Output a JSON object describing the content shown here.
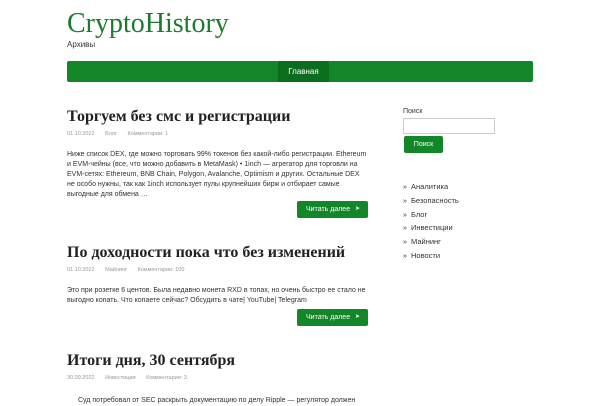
{
  "site": {
    "title": "CryptoHistory",
    "description": "Архивы"
  },
  "nav": {
    "home_label": "Главная"
  },
  "posts": [
    {
      "title": "Торгуем без смс и регистрации",
      "date": "01.10.2022",
      "category": "Блог",
      "comments": "Комментарии: 1",
      "excerpt": "Ниже список DEX, где можно торговать 99% токенов без какой-либо регистрации. Ethereum и EVM-чейны (все, что можно добавить в MetaMask) • 1inch — агрегатор для торговли на EVM-сетях: Ethereum, BNB Chain, Polygon, Avalanche, Optimism и других. Остальные DEX не особо нужны, так как 1inch использует пулы крупнейших бирж и отбирает самые выгодные для обмена …",
      "read_more": "Читать далее"
    },
    {
      "title": "По доходности пока что без изменений",
      "date": "01.10.2022",
      "category": "Майнинг",
      "comments": "Комментарии: 100",
      "excerpt": "Это при розетке 6 центов. Была недавно монета RXD в топах, но очень быстро ее стало не выгодно копать. Что копаете сейчас? Обсудить в чате| YouTube| Telegram",
      "read_more": "Читать далее"
    },
    {
      "title": "Итоги дня, 30 сентября",
      "date": "30.09.2022",
      "category": "Инвестиции",
      "comments": "Комментарии: 3",
      "excerpt": "Суд потребовал от SEC раскрыть документацию по делу Ripple — регулятор должен"
    }
  ],
  "sidebar": {
    "search_label": "Поиск",
    "search_value": "",
    "search_button": "Поиск",
    "categories": [
      "Аналитика",
      "Безопасность",
      "Блог",
      "Инвестиции",
      "Майнинг",
      "Новости"
    ]
  },
  "icons": {
    "read_more_arrow": "➤",
    "bullet": "»"
  },
  "colors": {
    "accent": "#13862a",
    "title": "#1e7b2e"
  }
}
